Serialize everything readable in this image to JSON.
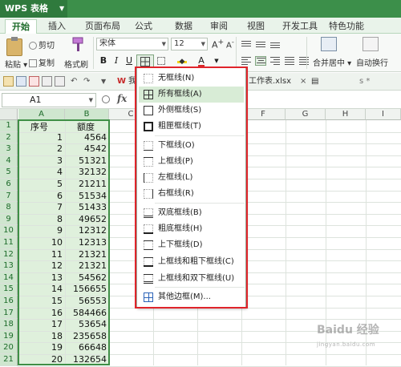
{
  "app": {
    "title": "WPS 表格"
  },
  "menu_tabs": [
    "开始",
    "插入",
    "页面布局",
    "公式",
    "数据",
    "审阅",
    "视图",
    "开发工具",
    "特色功能"
  ],
  "ribbon": {
    "cut": "剪切",
    "copy": "复制",
    "paste": "粘贴",
    "format_painter": "格式刷",
    "font_name": "宋体",
    "font_size": "12",
    "bold": "B",
    "italic": "I",
    "underline": "U",
    "merge_center": "合并居中",
    "wrap_text": "自动换行"
  },
  "quick_bar": {
    "doc_tab_1": "我",
    "doc_tab_2": "工作表.xlsx",
    "doc_tab_3": "s"
  },
  "formula_bar": {
    "cell_ref": "A1",
    "fx": "fx"
  },
  "sheet": {
    "columns": [
      "A",
      "B",
      "C",
      "D",
      "E",
      "F",
      "G",
      "H",
      "I"
    ],
    "header_row": {
      "a": "序号",
      "b": "额度"
    },
    "rows": [
      {
        "n": "1",
        "a": "1",
        "b": "4564"
      },
      {
        "n": "2",
        "a": "2",
        "b": "4542"
      },
      {
        "n": "3",
        "a": "3",
        "b": "51321"
      },
      {
        "n": "4",
        "a": "4",
        "b": "32132"
      },
      {
        "n": "5",
        "a": "5",
        "b": "21211"
      },
      {
        "n": "6",
        "a": "6",
        "b": "51534"
      },
      {
        "n": "7",
        "a": "7",
        "b": "51433"
      },
      {
        "n": "8",
        "a": "8",
        "b": "49652"
      },
      {
        "n": "9",
        "a": "9",
        "b": "12312"
      },
      {
        "n": "10",
        "a": "10",
        "b": "12313"
      },
      {
        "n": "11",
        "a": "11",
        "b": "21321"
      },
      {
        "n": "12",
        "a": "12",
        "b": "21321"
      },
      {
        "n": "13",
        "a": "13",
        "b": "54562"
      },
      {
        "n": "14",
        "a": "14",
        "b": "156655"
      },
      {
        "n": "15",
        "a": "15",
        "b": "56553"
      },
      {
        "n": "16",
        "a": "16",
        "b": "584466"
      },
      {
        "n": "17",
        "a": "17",
        "b": "53654"
      },
      {
        "n": "18",
        "a": "18",
        "b": "235658"
      },
      {
        "n": "19",
        "a": "19",
        "b": "66648"
      },
      {
        "n": "20",
        "a": "20",
        "b": "132654"
      }
    ],
    "row_numbers": [
      "1",
      "2",
      "3",
      "4",
      "5",
      "6",
      "7",
      "8",
      "9",
      "10",
      "11",
      "12",
      "13",
      "14",
      "15",
      "16",
      "17",
      "18",
      "19",
      "20",
      "21"
    ]
  },
  "border_menu": {
    "items": [
      {
        "label": "无框线(N)",
        "icon": "no-border-icon"
      },
      {
        "label": "所有框线(A)",
        "icon": "all-borders-icon",
        "highlighted": true
      },
      {
        "label": "外侧框线(S)",
        "icon": "outside-borders-icon"
      },
      {
        "label": "粗匣框线(T)",
        "icon": "thick-box-border-icon"
      },
      {
        "label": "下框线(O)",
        "icon": "bottom-border-icon"
      },
      {
        "label": "上框线(P)",
        "icon": "top-border-icon"
      },
      {
        "label": "左框线(L)",
        "icon": "left-border-icon"
      },
      {
        "label": "右框线(R)",
        "icon": "right-border-icon"
      },
      {
        "label": "双底框线(B)",
        "icon": "double-bottom-border-icon"
      },
      {
        "label": "粗底框线(H)",
        "icon": "thick-bottom-border-icon"
      },
      {
        "label": "上下框线(D)",
        "icon": "top-bottom-border-icon"
      },
      {
        "label": "上框线和粗下框线(C)",
        "icon": "top-thick-bottom-border-icon"
      },
      {
        "label": "上框线和双下框线(U)",
        "icon": "top-double-bottom-border-icon"
      },
      {
        "label": "其他边框(M)...",
        "icon": "more-borders-icon"
      }
    ]
  },
  "colors": {
    "accent": "#3c8f4a",
    "selection": "#dff0dc",
    "highlight_frame": "#e0242b"
  }
}
